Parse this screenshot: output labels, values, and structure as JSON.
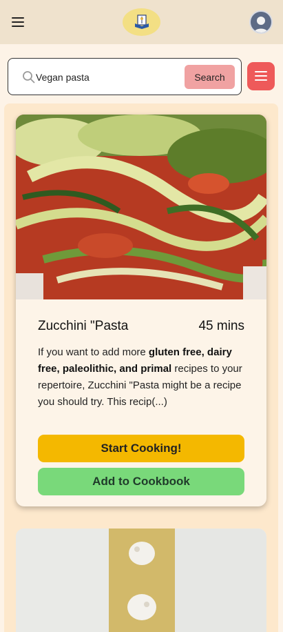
{
  "header": {
    "menu_icon": "hamburger-menu-icon",
    "logo_icon": "book-logo-icon",
    "avatar_icon": "user-avatar-icon"
  },
  "search": {
    "value": "Vegan pasta",
    "button_label": "Search",
    "filter_icon": "hamburger-filter-icon"
  },
  "recipes": [
    {
      "title": "Zucchini \"Pasta",
      "time": "45 mins",
      "desc_prefix": "If you want to add more ",
      "desc_bold": "gluten free, dairy free, paleolithic, and primal",
      "desc_suffix": " recipes to your repertoire, Zucchini \"Pasta might be a recipe you should try. This recip(...)",
      "start_label": "Start Cooking!",
      "add_label": "Add to Cookbook"
    }
  ],
  "colors": {
    "header_bg": "#efe2cd",
    "page_bg": "#fdf3e7",
    "search_button": "#f0a2a2",
    "filter_button": "#ee5a5a",
    "start_button": "#f4b800",
    "add_button": "#79d97a"
  }
}
